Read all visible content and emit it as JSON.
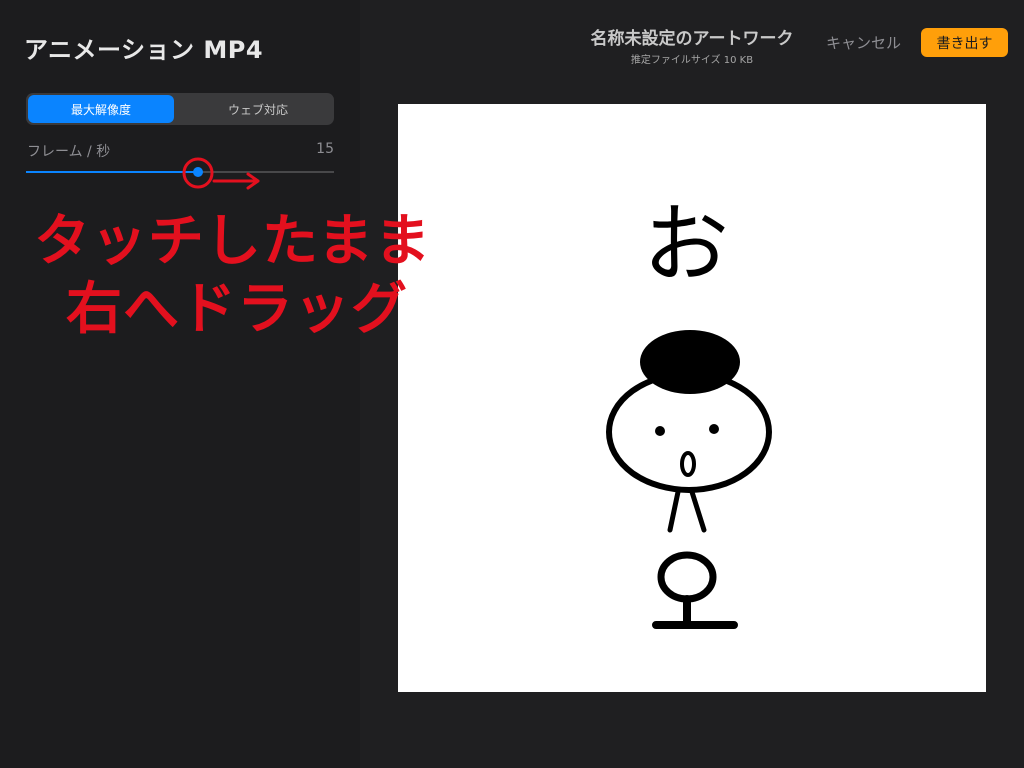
{
  "panel": {
    "title": "アニメーション MP4",
    "segments": [
      "最大解像度",
      "ウェブ対応"
    ],
    "selected_segment": "最大解像度",
    "fps_label": "フレーム / 秒",
    "fps_value": "15",
    "slider_fraction": 0.56
  },
  "header": {
    "title": "名称未設定のアートワーク",
    "subtitle": "推定ファイルサイズ 10 KB",
    "cancel_label": "キャンセル",
    "export_label": "書き出す"
  },
  "annotation": {
    "line1": "タッチしたまま",
    "line2": "右へドラッグ"
  },
  "artwork": {
    "text": "お"
  },
  "colors": {
    "accent": "#0a84ff",
    "export": "#ff9f0a",
    "annotation": "#e3101e"
  }
}
